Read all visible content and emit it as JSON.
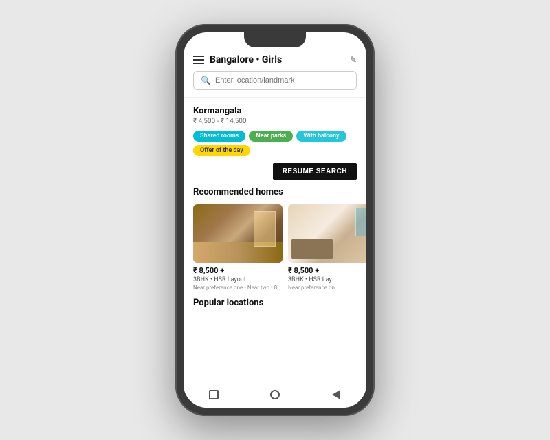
{
  "phone": {
    "header": {
      "title": "Bangalore",
      "subtitle": " • Girls",
      "edit_label": "✎"
    },
    "search": {
      "placeholder": "Enter location/landmark"
    },
    "saved_search": {
      "location": "Kormangala",
      "price_range": "₹ 4,500 - ₹ 14,500",
      "tags": [
        {
          "label": "Shared rooms",
          "color": "teal"
        },
        {
          "label": "Near parks",
          "color": "green"
        },
        {
          "label": "With balcony",
          "color": "cyan"
        },
        {
          "label": "Offer of the day",
          "color": "yellow"
        }
      ],
      "resume_btn": "RESUME SEARCH"
    },
    "recommended": {
      "section_title": "Recommended homes",
      "homes": [
        {
          "price": "₹ 8,500 +",
          "type": "3BHK • HSR Layout",
          "prefs": "Near preference one • Near two • 8",
          "img_type": "room1"
        },
        {
          "price": "₹ 8,500 +",
          "type": "3BHK • HSR Lay...",
          "prefs": "Near preference on...",
          "img_type": "room2"
        }
      ]
    },
    "popular": {
      "section_title": "Popular locations"
    }
  }
}
